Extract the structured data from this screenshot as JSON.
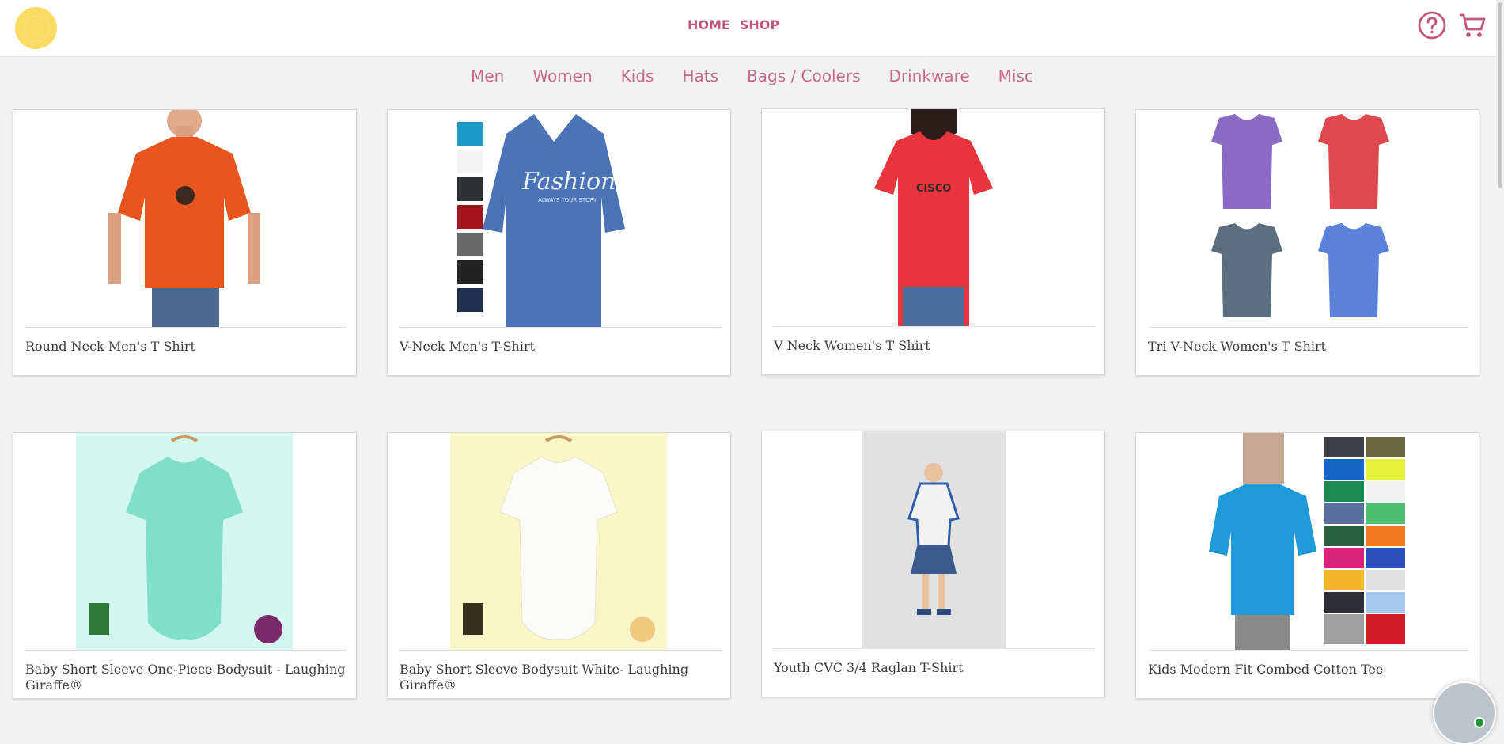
{
  "header": {
    "nav": [
      "HOME",
      "SHOP"
    ],
    "brand_color": "#c2547e",
    "logo_color": "#fbdb63",
    "icons": [
      "help-icon",
      "cart-icon"
    ]
  },
  "categories": [
    "Men",
    "Women",
    "Kids",
    "Hats",
    "Bags / Coolers",
    "Drinkware",
    "Misc"
  ],
  "products": [
    {
      "title": "Round Neck Men's T Shirt"
    },
    {
      "title": "V-Neck Men's T-Shirt",
      "graphic_text": "Fashion",
      "graphic_subtext": "ALWAYS YOUR STORY"
    },
    {
      "title": "V Neck Women's T Shirt",
      "graphic_text": "CISCO"
    },
    {
      "title": "Tri V-Neck Women's T Shirt"
    },
    {
      "title_lines": [
        "Baby Short Sleeve One-Piece Bodysuit - Laughing",
        "Giraffe®"
      ]
    },
    {
      "title_lines": [
        "Baby Short Sleeve Bodysuit White- Laughing",
        "Giraffe®"
      ]
    },
    {
      "title": "Youth CVC 3/4 Raglan T-Shirt"
    },
    {
      "title": "Kids Modern Fit Combed Cotton Tee"
    }
  ]
}
